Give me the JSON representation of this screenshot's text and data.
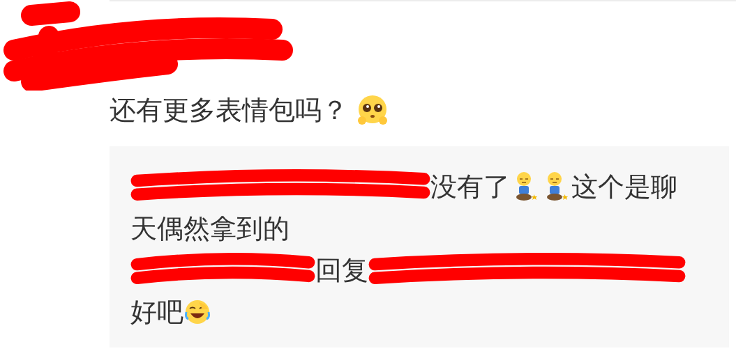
{
  "header": {
    "kind": "redaction"
  },
  "comment": {
    "segments": [
      {
        "kind": "text",
        "text": "还有更多表情包吗？"
      },
      {
        "kind": "pleading"
      }
    ]
  },
  "reply_box": {
    "lines": [
      {
        "segments": [
          {
            "kind": "redaction"
          },
          {
            "kind": "text",
            "text": "没有了"
          },
          {
            "kind": "kneeling"
          },
          {
            "kind": "kneeling"
          },
          {
            "kind": "text",
            "text": "这个是聊"
          }
        ]
      },
      {
        "segments": [
          {
            "kind": "text",
            "text": "天偶然拿到的"
          }
        ]
      },
      {
        "segments": [
          {
            "kind": "redaction"
          },
          {
            "kind": "text",
            "text": "回复"
          },
          {
            "kind": "redaction"
          }
        ]
      },
      {
        "segments": [
          {
            "kind": "text",
            "text": "好吧"
          },
          {
            "kind": "laughing"
          }
        ]
      }
    ]
  }
}
